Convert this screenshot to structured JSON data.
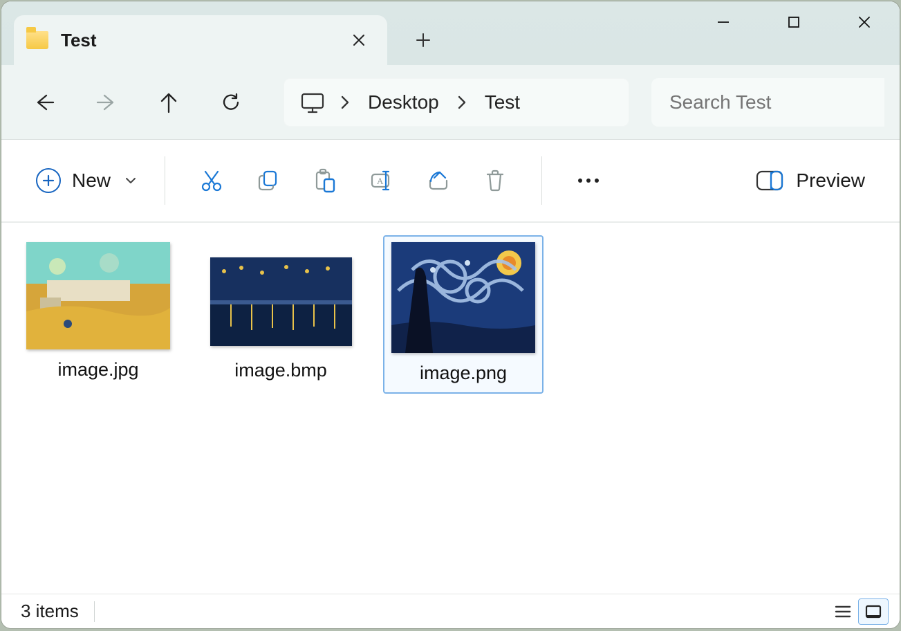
{
  "tab": {
    "title": "Test"
  },
  "breadcrumb": {
    "segments": [
      "Desktop",
      "Test"
    ]
  },
  "search": {
    "placeholder": "Search Test"
  },
  "toolbar": {
    "new_label": "New",
    "preview_label": "Preview"
  },
  "files": [
    {
      "name": "image.jpg",
      "selected": false,
      "kind": "farmhouse"
    },
    {
      "name": "image.bmp",
      "selected": false,
      "kind": "rhone"
    },
    {
      "name": "image.png",
      "selected": true,
      "kind": "starry"
    }
  ],
  "status": {
    "text": "3 items"
  }
}
